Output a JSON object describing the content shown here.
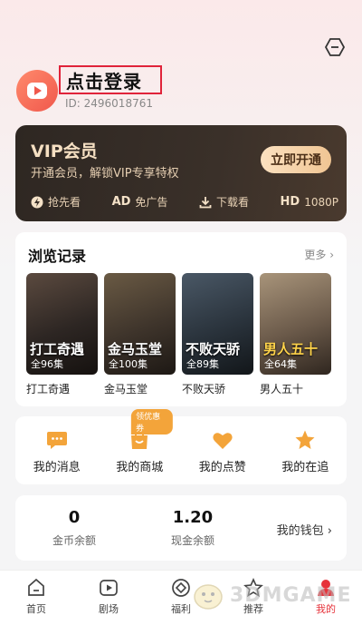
{
  "user": {
    "login_label": "点击登录",
    "id_label": "ID: 2496018761"
  },
  "vip": {
    "title": "VIP会员",
    "subtitle": "开通会员，解锁VIP专享特权",
    "open_label": "立即开通",
    "perks": [
      {
        "icon": "lightning-icon",
        "label": "抢先看"
      },
      {
        "icon": "ad-icon",
        "label": "免广告",
        "badge": "AD"
      },
      {
        "icon": "download-icon",
        "label": "下载看"
      },
      {
        "icon": "hd-icon",
        "label": "1080P",
        "badge": "HD"
      }
    ]
  },
  "history": {
    "title": "浏览记录",
    "more_label": "更多",
    "items": [
      {
        "title": "打工奇遇",
        "episodes": "全96集",
        "poster_text": "打工奇遇"
      },
      {
        "title": "金马玉堂",
        "episodes": "全100集",
        "poster_text": "金马玉堂"
      },
      {
        "title": "不败天骄",
        "episodes": "全89集",
        "poster_text": "不败天骄"
      },
      {
        "title": "男人五十",
        "episodes": "全64集",
        "poster_text": "男人五十"
      }
    ]
  },
  "actions": [
    {
      "icon": "message-icon",
      "label": "我的消息"
    },
    {
      "icon": "shop-icon",
      "label": "我的商城",
      "badge": "领优惠券"
    },
    {
      "icon": "heart-icon",
      "label": "我的点赞"
    },
    {
      "icon": "star-icon",
      "label": "我的在追"
    }
  ],
  "wallet": {
    "coins_value": "0",
    "coins_label": "金币余额",
    "cash_value": "1.20",
    "cash_label": "现金余额",
    "link_label": "我的钱包"
  },
  "tabs": [
    {
      "icon": "home-icon",
      "label": "首页"
    },
    {
      "icon": "theater-icon",
      "label": "剧场"
    },
    {
      "icon": "gift-icon",
      "label": "福利"
    },
    {
      "icon": "like-icon",
      "label": "推荐"
    },
    {
      "icon": "profile-icon",
      "label": "我的"
    }
  ],
  "colors": {
    "accent": "#e6333b",
    "vip_gold": "#f0c593",
    "icon_orange": "#f3a43a"
  },
  "watermark": "3DMGAME"
}
